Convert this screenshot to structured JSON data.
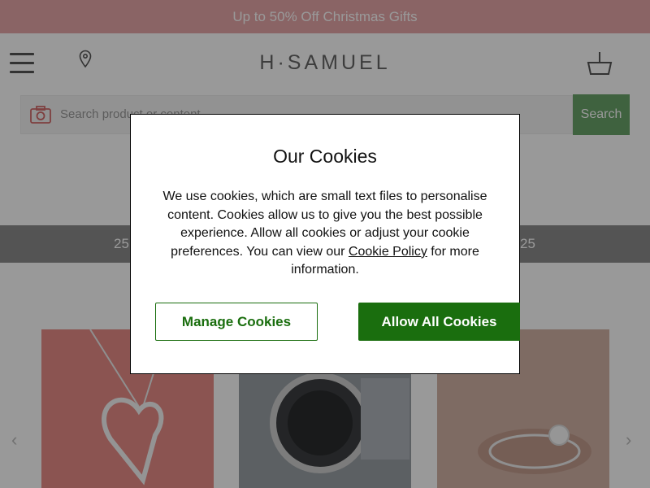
{
  "promo": {
    "text": "Up to 50% Off Christmas Gifts"
  },
  "header": {
    "logo": "H·SAMUEL"
  },
  "search": {
    "placeholder": "Search product or content",
    "button_label": "Search"
  },
  "banner": {
    "left_text": "25",
    "right_text": "25"
  },
  "products": [
    {
      "icon": "heart-pendant-image"
    },
    {
      "icon": "watch-image"
    },
    {
      "icon": "ring-image"
    }
  ],
  "cookie_modal": {
    "title": "Our Cookies",
    "body_before_link": "We use cookies, which are small text files to personalise content. Cookies allow us to give you the best possible experience. Allow all cookies or adjust your cookie preferences. You can view our ",
    "link_text": "Cookie Policy",
    "body_after_link": " for more information.",
    "manage_label": "Manage Cookies",
    "allow_label": "Allow All Cookies"
  },
  "colors": {
    "brand_green": "#1a6e0e",
    "promo_pink": "#e6a7a9"
  }
}
